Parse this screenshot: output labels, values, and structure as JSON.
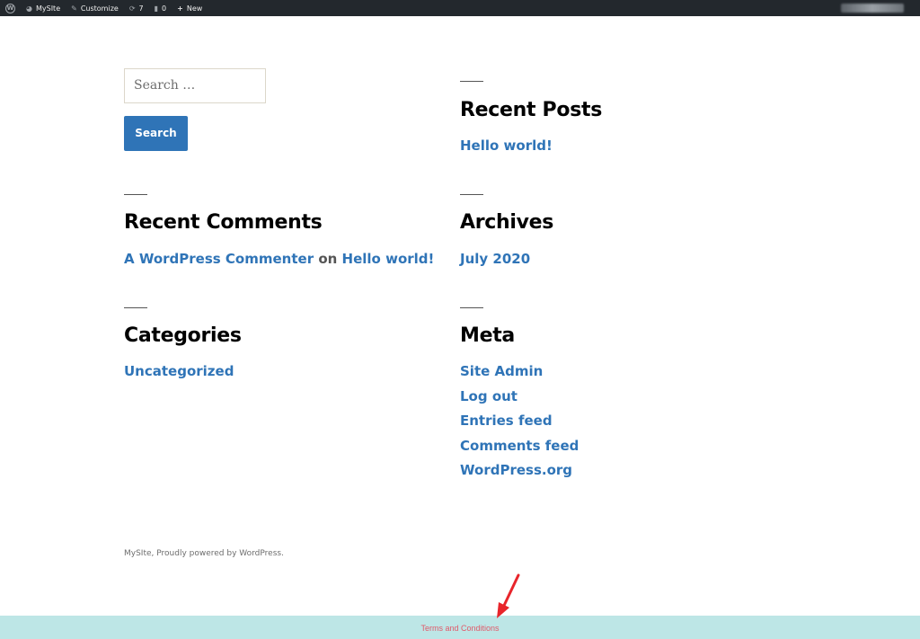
{
  "adminbar": {
    "site_name": "MySIte",
    "customize": "Customize",
    "updates_count": "7",
    "comments_count": "0",
    "new_label": "New"
  },
  "search": {
    "placeholder": "Search …",
    "button_label": "Search"
  },
  "widgets": {
    "recent_posts": {
      "title": "Recent Posts",
      "items": [
        "Hello world!"
      ]
    },
    "recent_comments": {
      "title": "Recent Comments",
      "author": "A WordPress Commenter",
      "connector": "on",
      "post": "Hello world!"
    },
    "archives": {
      "title": "Archives",
      "items": [
        "July 2020"
      ]
    },
    "categories": {
      "title": "Categories",
      "items": [
        "Uncategorized"
      ]
    },
    "meta": {
      "title": "Meta",
      "items": [
        "Site Admin",
        "Log out",
        "Entries feed",
        "Comments feed",
        "WordPress.org"
      ]
    }
  },
  "footer": {
    "credit": "MySIte, Proudly powered by WordPress.",
    "terms_link": "Terms and Conditions"
  },
  "colors": {
    "adminbar_bg": "#23282d",
    "link": "#2f74b7",
    "terms_bar_bg": "#bde6e6",
    "terms_link": "#e05a6a",
    "annotation_arrow": "#e8252b"
  }
}
